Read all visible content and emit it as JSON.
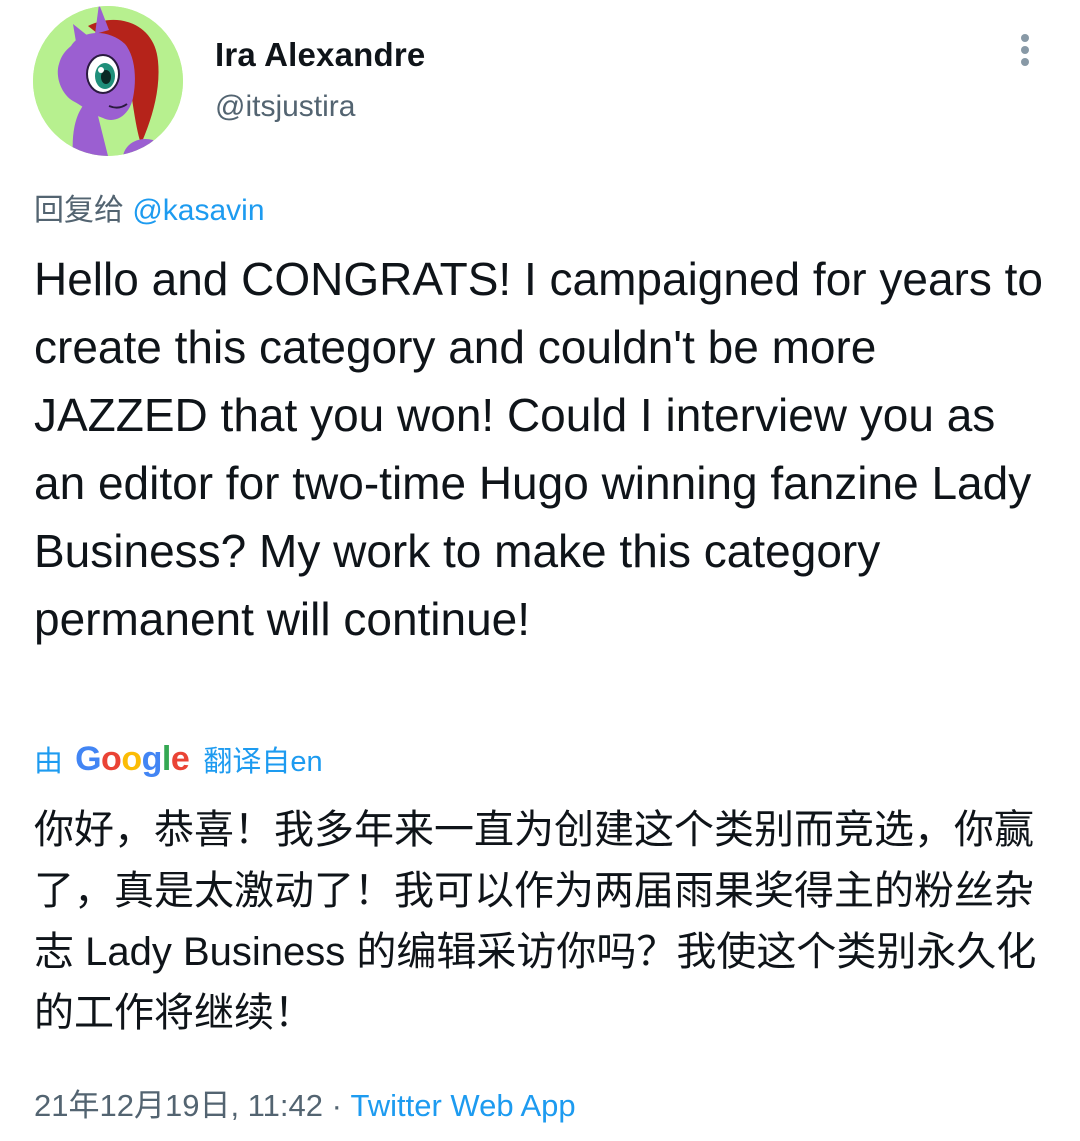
{
  "author": {
    "display_name": "Ira Alexandre",
    "handle": "@itsjustira",
    "avatar_icon": "pony-avatar-icon"
  },
  "more_icon": "more-vertical-icon",
  "reply": {
    "prefix": "回复给",
    "mention": "@kasavin"
  },
  "tweet": {
    "text": "Hello and CONGRATS! I campaigned for years to create this category and couldn't be more JAZZED that you won! Could I interview you as an editor for two-time Hugo winning fanzine Lady Business? My work to make this category permanent will continue!"
  },
  "translation": {
    "by": "由",
    "provider": "Google",
    "from": "翻译自en",
    "text": "你好，恭喜！我多年来一直为创建这个类别而竞选，你赢了，真是太激动了！我可以作为两届雨果奖得主的粉丝杂志 Lady Business 的编辑采访你吗？我使这个类别永久化的工作将继续！"
  },
  "meta": {
    "timestamp": "21年12月19日, 11:42",
    "separator": " · ",
    "source": "Twitter Web App"
  },
  "colors": {
    "accent": "#1d9bf0",
    "text": "#0f1419",
    "secondary": "#536471",
    "avatar_bg": "#b7f08f",
    "google_blue": "#4285f4",
    "google_red": "#ea4335",
    "google_yellow": "#fbbc05",
    "google_green": "#34a853"
  }
}
